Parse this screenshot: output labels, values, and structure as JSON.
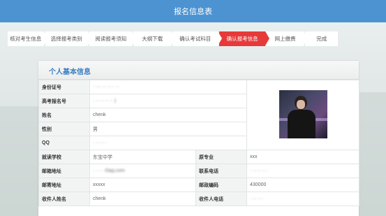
{
  "header": {
    "title": "报名信息表"
  },
  "steps": [
    {
      "label": "核对考生信息",
      "active": false
    },
    {
      "label": "选择报考类别",
      "active": false
    },
    {
      "label": "阅读报考须知",
      "active": false
    },
    {
      "label": "大纲下载",
      "active": false
    },
    {
      "label": "确认考试科目",
      "active": false
    },
    {
      "label": "确认报考信息",
      "active": true
    },
    {
      "label": "网上缴费",
      "active": false
    },
    {
      "label": "完成",
      "active": false
    }
  ],
  "panel": {
    "title": "个人基本信息"
  },
  "fields": {
    "id_number": {
      "label": "身份证号",
      "value": "· ··· ··· ·· · ··"
    },
    "exam_number": {
      "label": "高考报名号",
      "value": "· ·· ·· ·· ·· )"
    },
    "name": {
      "label": "姓名",
      "value": "chenk"
    },
    "gender": {
      "label": "性别",
      "value": "男"
    },
    "qq": {
      "label": "QQ",
      "value": "· ·· ·· ·"
    },
    "school": {
      "label": "就读学校",
      "value": "东宝中学"
    },
    "major": {
      "label": "原专业",
      "value": "xxx"
    },
    "email": {
      "label": "邮箱地址",
      "value": "· · ·· ·Oqq.com"
    },
    "phone": {
      "label": "联系电话",
      "value": "· ·· ·· ·· ·"
    },
    "postal_address": {
      "label": "邮寄地址",
      "value": "xxxxx"
    },
    "postcode": {
      "label": "邮政编码",
      "value": "430000"
    },
    "recipient_name": {
      "label": "收件人姓名",
      "value": "chenk"
    },
    "recipient_phone": {
      "label": "收件人电话",
      "value": "· ·· ·· ·"
    }
  }
}
